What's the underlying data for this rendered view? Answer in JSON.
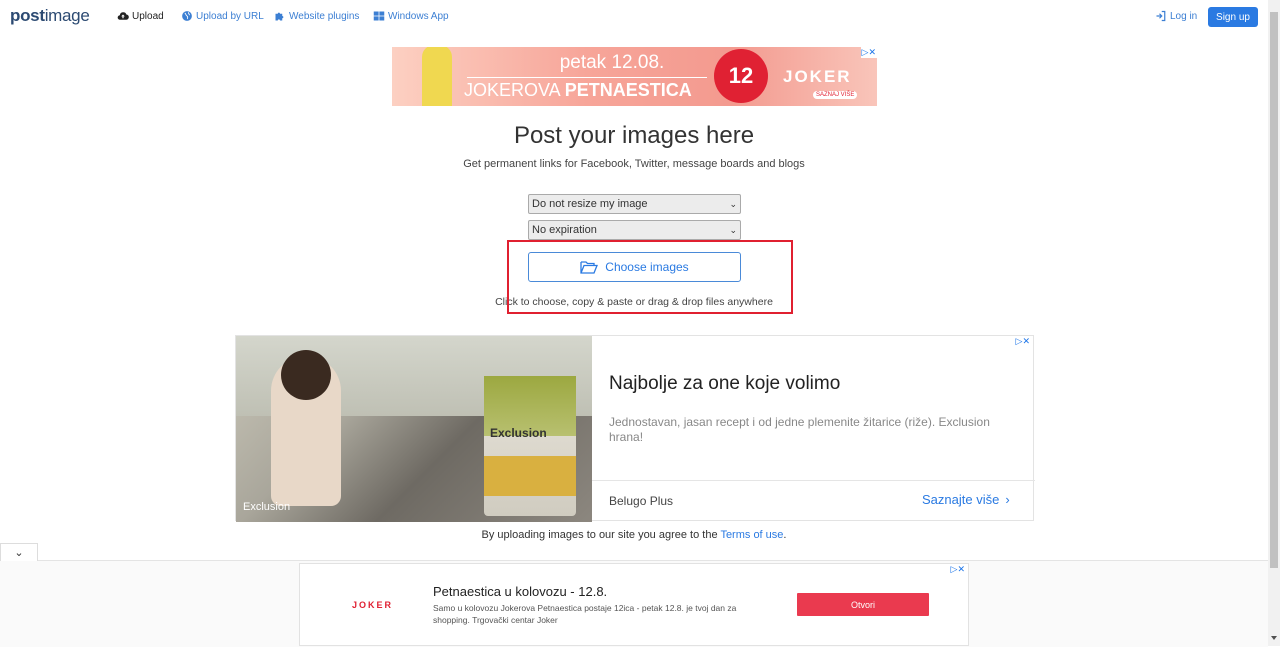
{
  "nav": {
    "logo_post": "post",
    "logo_image": "image",
    "upload": "Upload",
    "upload_by_url": "Upload by URL",
    "website_plugins": "Website plugins",
    "windows_app": "Windows App",
    "login": "Log in",
    "signup": "Sign up"
  },
  "top_ad": {
    "line1": "petak 12.08.",
    "line2_a": "JOKEROVA ",
    "line2_b": "PETNAESTICA",
    "badge": "12",
    "brand": "JOKER",
    "cta": "SAZNAJ VIŠE"
  },
  "main": {
    "title": "Post your images here",
    "subtitle": "Get permanent links for Facebook, Twitter, message boards and blogs",
    "resize_value": "Do not resize my image",
    "expiration_value": "No expiration",
    "choose_button": "Choose images",
    "hint": "Click to choose, copy & paste or drag & drop files anywhere"
  },
  "mid_ad": {
    "photo_caption": "Exclusion",
    "bag_name": "Exclusion",
    "title": "Najbolje za one koje volimo",
    "description": "Jednostavan, jasan recept i od jedne plemenite žitarice (riže). Exclusion hrana!",
    "brand": "Belugo Plus",
    "cta": "Saznajte više"
  },
  "terms": {
    "prefix": "By uploading images to our site you agree to the ",
    "link": "Terms of use",
    "suffix": "."
  },
  "bottom_ad": {
    "logo": "JOKER",
    "title": "Petnaestica u kolovozu - 12.8.",
    "description": "Samo u kolovozu Jokerova Petnaestica postaje 12ica - petak 12.8. je tvoj dan za shopping. Trgovački centar Joker",
    "button": "Otvori"
  },
  "colors": {
    "accent": "#2a7ae2",
    "highlight_box": "#e02030",
    "ad_red": "#e02133"
  }
}
